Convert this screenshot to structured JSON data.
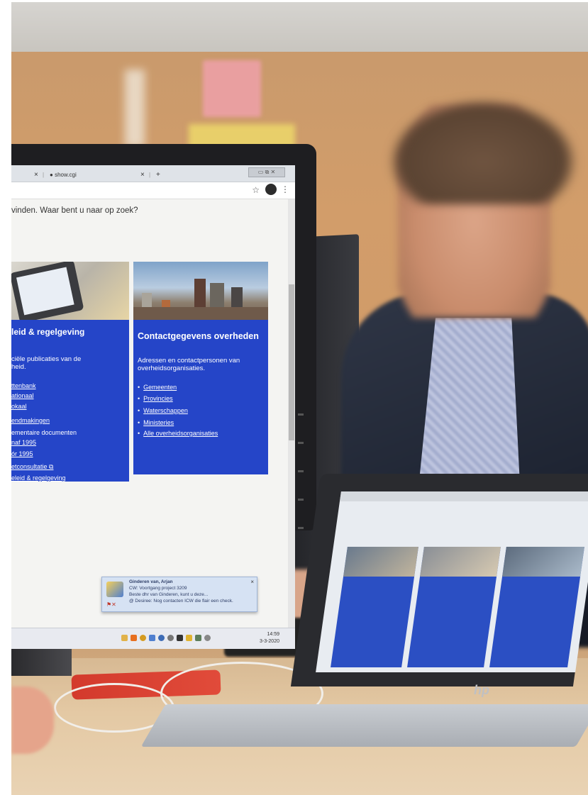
{
  "browser": {
    "tab1_close": "×",
    "tab2_label": "show.cgi",
    "tab2_close": "×",
    "new_tab": "+",
    "window_buttons": "▭ ⧉ ✕",
    "bookmark_star": "☆",
    "menu_dots": "⋮"
  },
  "page": {
    "question": "vinden. Waar bent u naar op zoek?",
    "left_card": {
      "title": "leid & regelgeving",
      "intro": "ciële publicaties van de\nheid.",
      "links": [
        "ttenbank",
        "ationaal",
        "okaal",
        "endmakingen",
        "ementaire documenten",
        "naf 1995",
        "ór 1995",
        "etconsultatie ⧉",
        "eleid & regelgeving"
      ]
    },
    "right_card": {
      "title": "Contactgegevens overheden",
      "intro": "Adressen en contactpersonen van overheidsorganisaties.",
      "links": [
        "Gemeenten",
        "Provincies",
        "Waterschappen",
        "Ministeries",
        "Alle overheidsorganisaties"
      ]
    }
  },
  "notification": {
    "line1": "Ginderen van, Arjan",
    "line2": "CW: Voortgang project 3209",
    "line3": "Beste dhr van Ginderen, kunt u deze...",
    "line4": "@ Desiree: Nog contacten ICW die flair een check.",
    "close": "×"
  },
  "taskbar": {
    "time": "14:59",
    "date": "3-3-2020"
  },
  "laptop": {
    "brand": "hp"
  },
  "colors": {
    "page_blue": "#2545c8",
    "notification_bg": "#d6e2f3"
  }
}
